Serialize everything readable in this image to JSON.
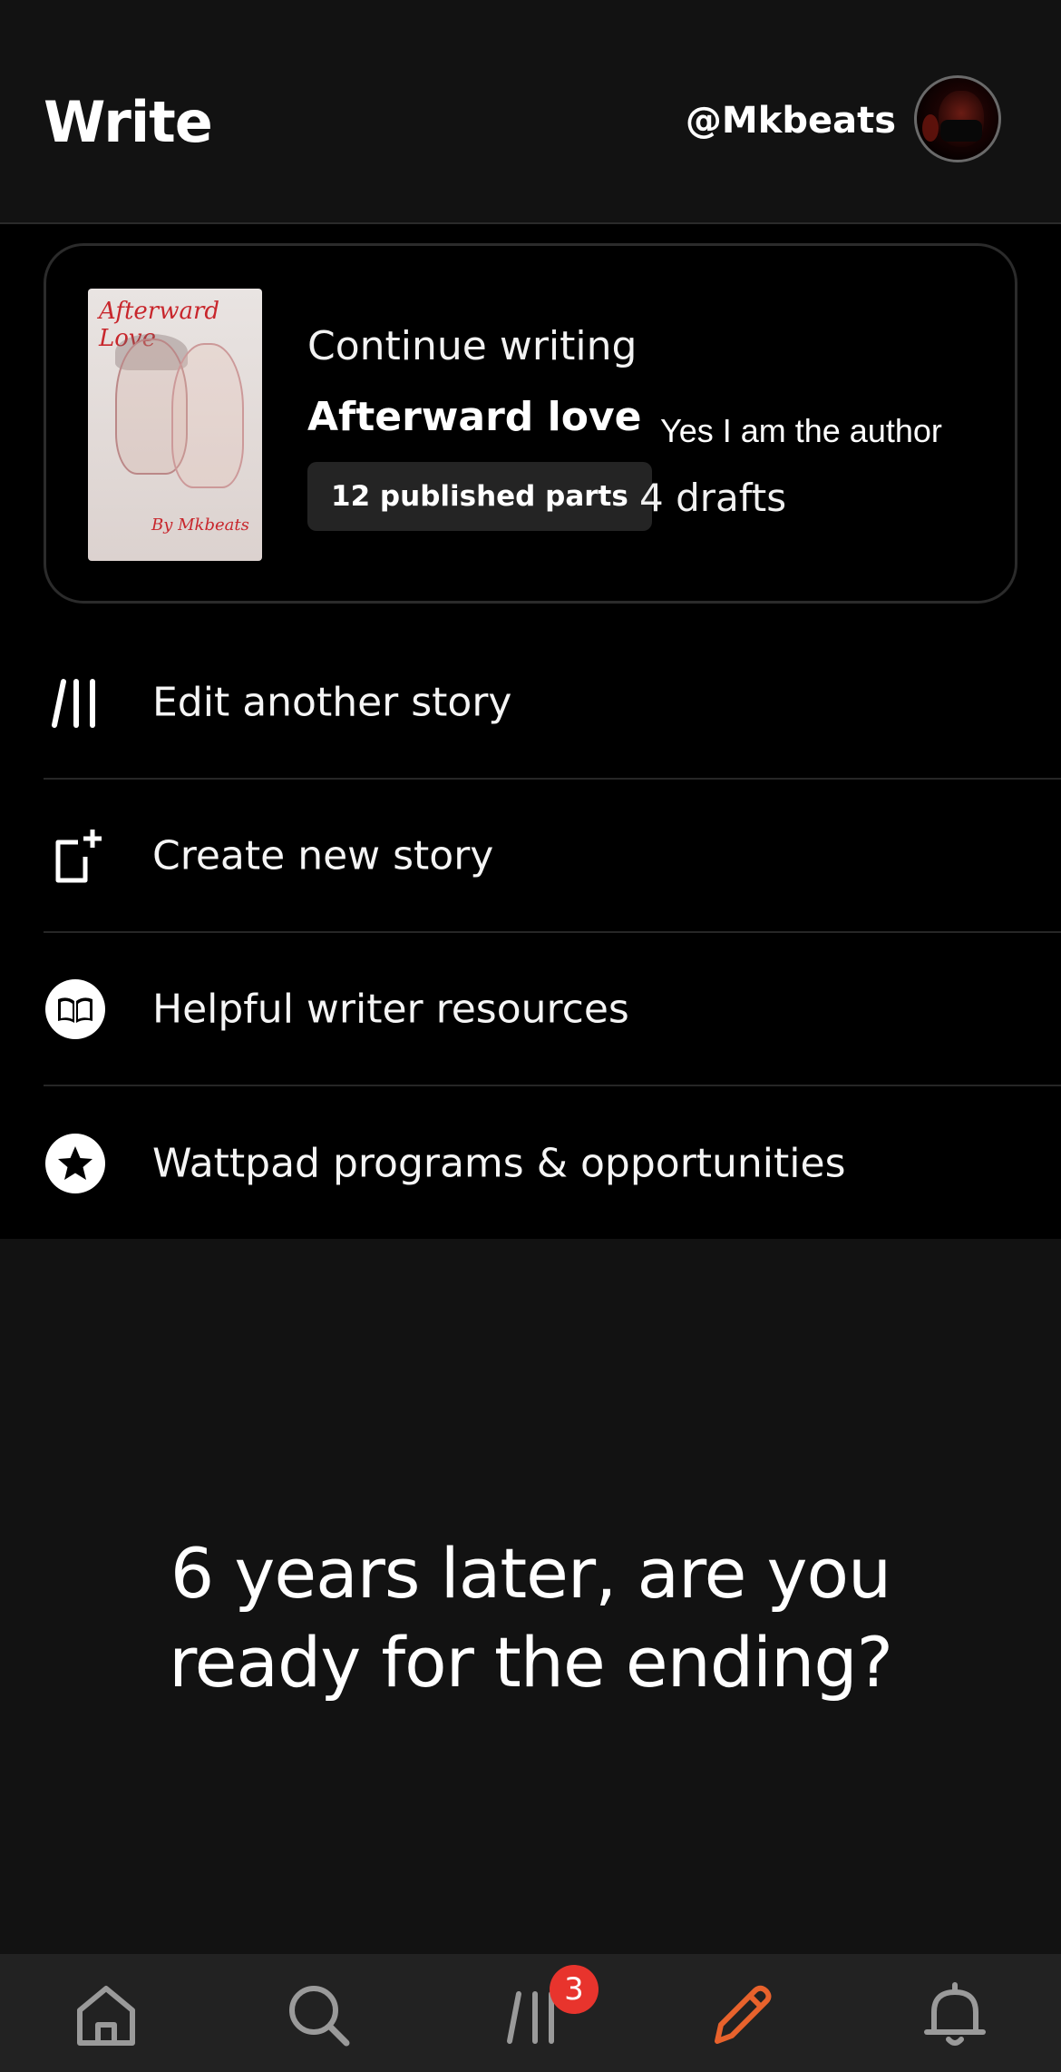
{
  "header": {
    "title": "Write",
    "username": "@Mkbeats"
  },
  "continue_card": {
    "label": "Continue writing",
    "story_title": "Afterward love",
    "author_note": "Yes I am the author",
    "published_parts": "12 published parts",
    "drafts": "4 drafts",
    "cover": {
      "title": "Afterward Love",
      "byline": "By Mkbeats"
    }
  },
  "menu": {
    "items": [
      {
        "label": "Edit another story",
        "icon": "library-icon"
      },
      {
        "label": "Create new story",
        "icon": "new-story-icon"
      },
      {
        "label": "Helpful writer resources",
        "icon": "book-icon"
      },
      {
        "label": "Wattpad programs & opportunities",
        "icon": "star-icon"
      }
    ]
  },
  "promo": {
    "line1": "6 years later, are you",
    "line2": "ready for the ending?"
  },
  "bottom_nav": {
    "items": [
      "home-icon",
      "search-icon",
      "library-icon",
      "write-icon",
      "notifications-icon"
    ],
    "library_badge": "3",
    "active": "write-icon",
    "active_color": "#e8622c",
    "inactive_color": "#9a9a9a"
  }
}
